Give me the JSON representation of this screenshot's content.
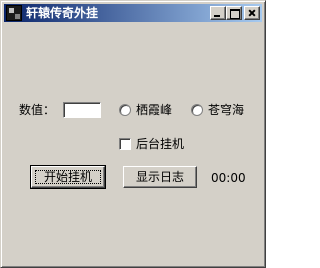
{
  "window": {
    "title": "轩辕传奇外挂",
    "controls": {
      "minimize_icon": "minimize-icon",
      "maximize_icon": "maximize-icon",
      "close_icon": "close-icon"
    },
    "app_icon": "app-icon"
  },
  "form": {
    "value_label": "数值：",
    "value_input": "",
    "radio_options": [
      "栖霞峰",
      "苍穹海"
    ],
    "background_checkbox_label": "后台挂机",
    "start_button": "开始挂机",
    "log_button": "显示日志",
    "timer": "00:00"
  },
  "colors": {
    "titlebar_start": "#0a246a",
    "titlebar_end": "#a6caf0",
    "face": "#d4d0c8"
  }
}
